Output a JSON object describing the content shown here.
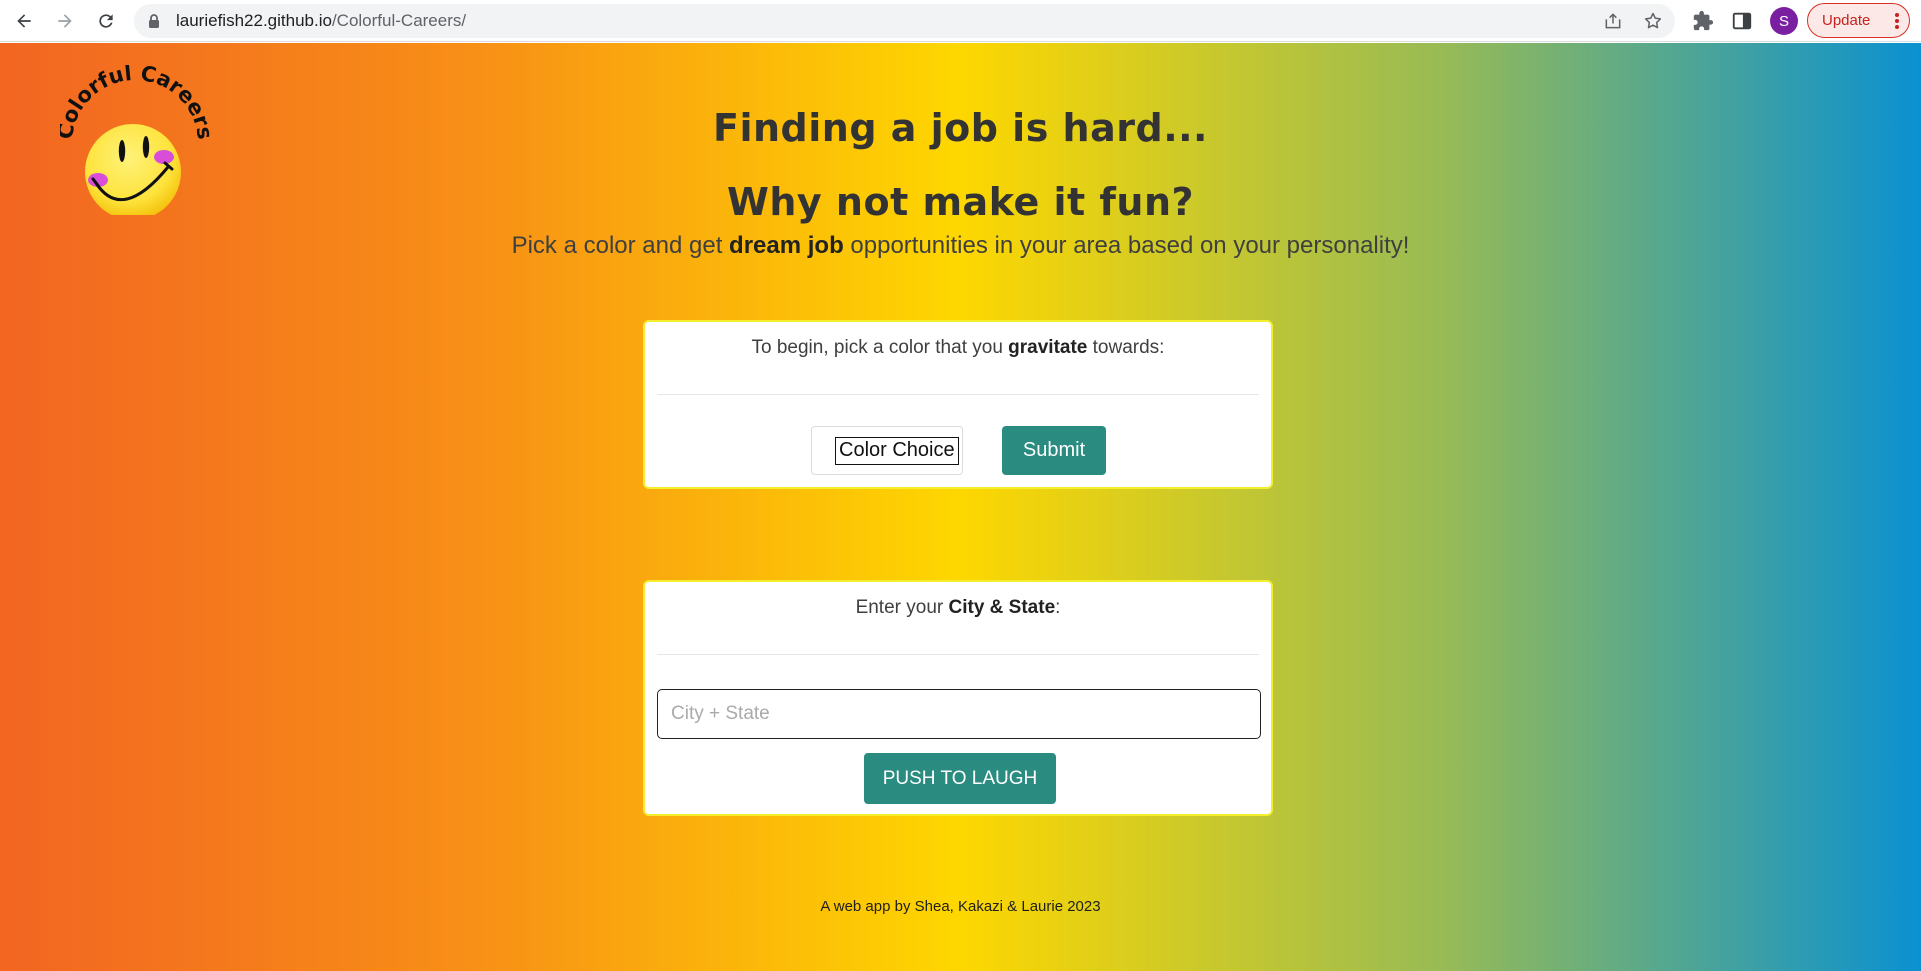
{
  "browser": {
    "url_host": "lauriefish22.github.io",
    "url_path": "/Colorful-Careers/",
    "avatar_letter": "S",
    "update_label": "Update",
    "icons": [
      "back-icon",
      "forward-icon",
      "reload-icon",
      "lock-icon",
      "share-icon",
      "star-icon",
      "extensions-icon",
      "side-panel-icon",
      "more-icon"
    ]
  },
  "logo": {
    "text": "Colorful Careers",
    "colors": {
      "face": "#fde33b",
      "cheeks": "#d84ed9",
      "ink": "#111111"
    }
  },
  "hero": {
    "line1": "Finding a job is hard...",
    "line2": "Why not make it fun?",
    "tagline_before": "Pick a color and get ",
    "tagline_bold": "dream job",
    "tagline_after": " opportunities in your area based on your personality!"
  },
  "color_card": {
    "label_before": "To begin, pick a color that you ",
    "label_bold": "gravitate",
    "label_after": " towards:",
    "select_value": "Color Choice",
    "submit_label": "Submit"
  },
  "city_card": {
    "label_before": "Enter your ",
    "label_bold": "City & State",
    "label_after": ":",
    "input_placeholder": "City + State",
    "input_value": "",
    "button_label": "PUSH TO LAUGH"
  },
  "footer": {
    "text": "A web app by Shea, Kakazi & Laurie 2023"
  },
  "theme": {
    "accent": "#2a8b80",
    "card_border": "#f3ef2f",
    "gradient": [
      "#f26522",
      "#f89016",
      "#fed700",
      "#98bb55",
      "#0a91d1"
    ]
  }
}
